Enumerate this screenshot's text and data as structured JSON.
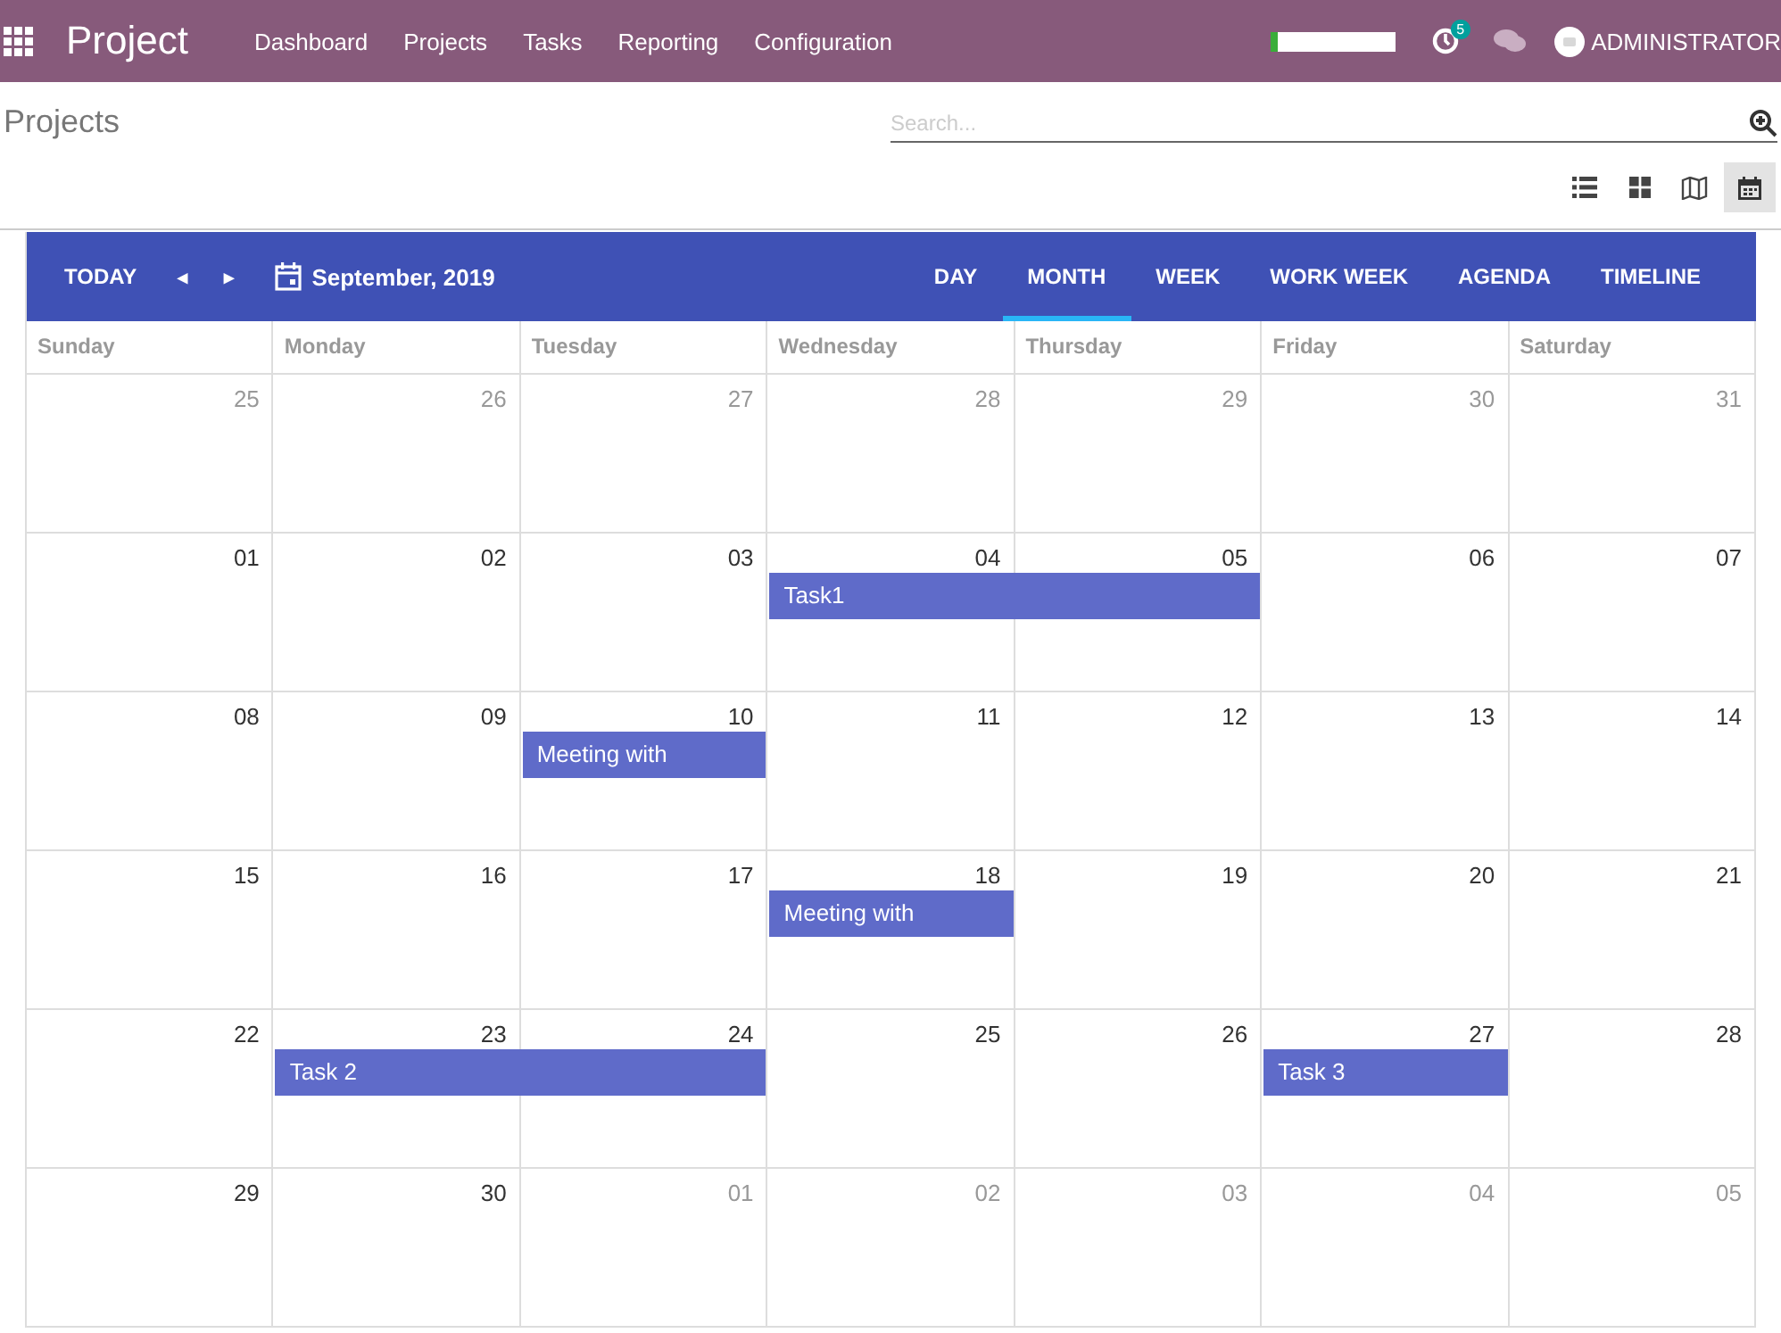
{
  "navbar": {
    "app_title": "Project",
    "menu": [
      "Dashboard",
      "Projects",
      "Tasks",
      "Reporting",
      "Configuration"
    ],
    "progress": {
      "level": 0.06
    },
    "activity_count": "5",
    "user": "ADMINISTRATOR"
  },
  "control_panel": {
    "breadcrumb": "Projects",
    "search": {
      "placeholder": "Search..."
    },
    "views": [
      {
        "kind": "list",
        "selected": false
      },
      {
        "kind": "kanban",
        "selected": false
      },
      {
        "kind": "map",
        "selected": false
      },
      {
        "kind": "calendar",
        "selected": true
      }
    ]
  },
  "calendar": {
    "today": "TODAY",
    "prev": "◂",
    "next": "▸",
    "period": "September, 2019",
    "modes": [
      {
        "label": "DAY",
        "selected": false
      },
      {
        "label": "MONTH",
        "selected": true
      },
      {
        "label": "WEEK",
        "selected": false
      },
      {
        "label": "WORK WEEK",
        "selected": false
      },
      {
        "label": "AGENDA",
        "selected": false
      },
      {
        "label": "TIMELINE",
        "selected": false
      }
    ],
    "weekdays": [
      "Sunday",
      "Monday",
      "Tuesday",
      "Wednesday",
      "Thursday",
      "Friday",
      "Saturday"
    ],
    "weeks": [
      {
        "days": [
          {
            "date": "25",
            "other_month": true
          },
          {
            "date": "26",
            "other_month": true
          },
          {
            "date": "27",
            "other_month": true
          },
          {
            "date": "28",
            "other_month": true
          },
          {
            "date": "29",
            "other_month": true
          },
          {
            "date": "30",
            "other_month": true
          },
          {
            "date": "31",
            "other_month": true
          }
        ]
      },
      {
        "days": [
          {
            "date": "01",
            "other_month": false
          },
          {
            "date": "02",
            "other_month": false
          },
          {
            "date": "03",
            "other_month": false
          },
          {
            "date": "04",
            "other_month": false,
            "event": {
              "title": "Task1"
            }
          },
          {
            "date": "05",
            "other_month": false,
            "event_continues": true
          },
          {
            "date": "06",
            "other_month": false
          },
          {
            "date": "07",
            "other_month": false
          }
        ]
      },
      {
        "days": [
          {
            "date": "08",
            "other_month": false
          },
          {
            "date": "09",
            "other_month": false
          },
          {
            "date": "10",
            "other_month": false,
            "event": {
              "title": "Meeting with"
            }
          },
          {
            "date": "11",
            "other_month": false
          },
          {
            "date": "12",
            "other_month": false
          },
          {
            "date": "13",
            "other_month": false
          },
          {
            "date": "14",
            "other_month": false
          }
        ]
      },
      {
        "days": [
          {
            "date": "15",
            "other_month": false
          },
          {
            "date": "16",
            "other_month": false
          },
          {
            "date": "17",
            "other_month": false
          },
          {
            "date": "18",
            "other_month": false,
            "event": {
              "title": "Meeting with"
            }
          },
          {
            "date": "19",
            "other_month": false
          },
          {
            "date": "20",
            "other_month": false
          },
          {
            "date": "21",
            "other_month": false
          }
        ]
      },
      {
        "days": [
          {
            "date": "22",
            "other_month": false
          },
          {
            "date": "23",
            "other_month": false,
            "event": {
              "title": "Task 2"
            }
          },
          {
            "date": "24",
            "other_month": false,
            "event_continues": true
          },
          {
            "date": "25",
            "other_month": false
          },
          {
            "date": "26",
            "other_month": false
          },
          {
            "date": "27",
            "other_month": false,
            "event": {
              "title": "Task 3"
            }
          },
          {
            "date": "28",
            "other_month": false
          }
        ]
      },
      {
        "days": [
          {
            "date": "29",
            "other_month": false
          },
          {
            "date": "30",
            "other_month": false
          },
          {
            "date": "01",
            "other_month": true
          },
          {
            "date": "02",
            "other_month": true
          },
          {
            "date": "03",
            "other_month": true
          },
          {
            "date": "04",
            "other_month": true
          },
          {
            "date": "05",
            "other_month": true
          }
        ]
      }
    ]
  }
}
